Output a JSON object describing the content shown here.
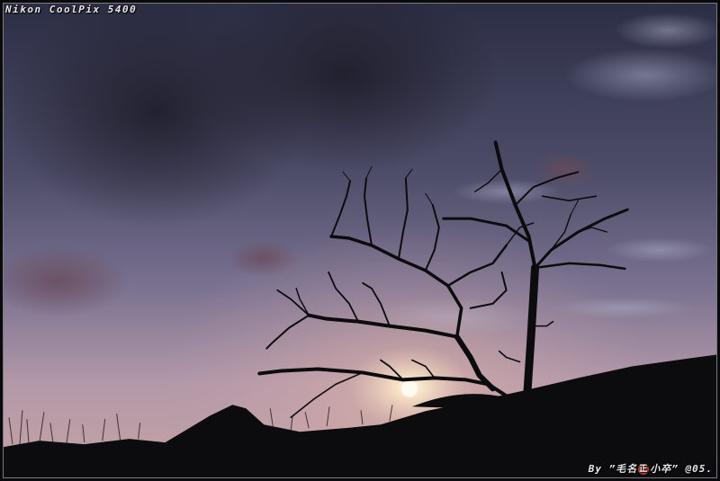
{
  "photo": {
    "subject": "bare-tree-silhouette-at-sunset",
    "colors": {
      "sky_top": "#2e3046",
      "sky_mid": "#6c6884",
      "sky_horizon": "#c9a6b0",
      "sun_glow": "#fff6e6",
      "silhouette": "#0c0b0e",
      "frame_border": "#7a7a80"
    }
  },
  "captions": {
    "camera": "Nikon CoolPix 5400",
    "credit_prefix": "By ”毛名",
    "credit_seal": "正",
    "credit_suffix": "小卒” @05."
  }
}
